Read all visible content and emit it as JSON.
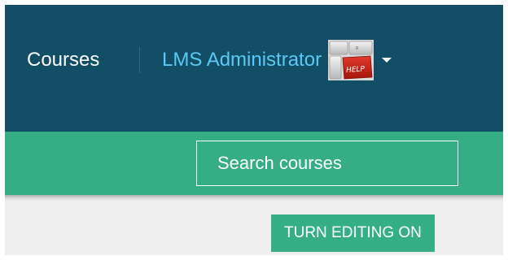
{
  "navbar": {
    "courses_label": "Courses",
    "user_name": "LMS Administrator",
    "avatar_text": "HELP",
    "colors": {
      "background": "#124e66",
      "user_link": "#5bc8f5"
    }
  },
  "search": {
    "placeholder": "Search courses",
    "value": ""
  },
  "page": {
    "edit_button_label": "TURN EDITING ON",
    "colors": {
      "accent": "#35ae85",
      "content_background": "#efefef"
    }
  }
}
